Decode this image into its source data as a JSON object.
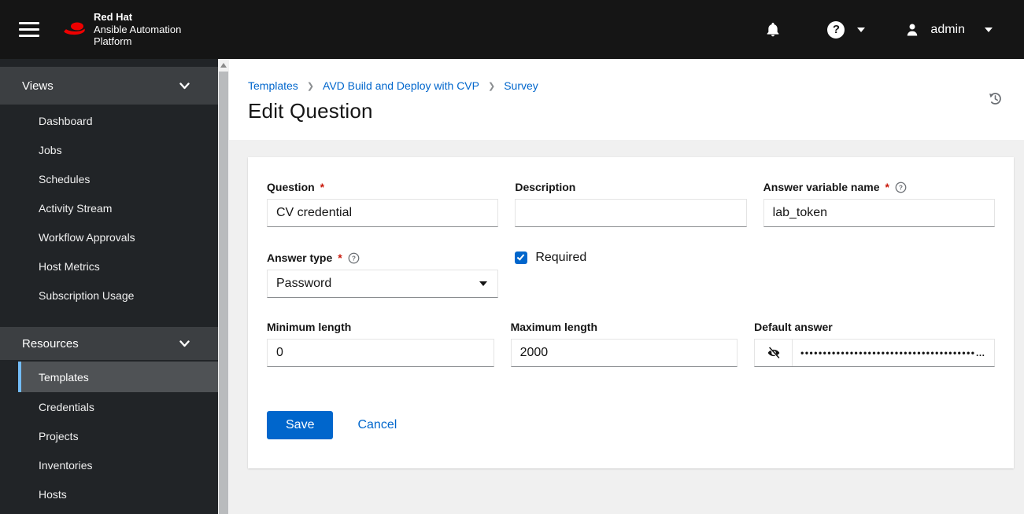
{
  "masthead": {
    "brand": {
      "line1": "Red Hat",
      "line2": "Ansible Automation",
      "line3": "Platform"
    },
    "user_menu": {
      "username": "admin"
    }
  },
  "sidebar": {
    "sections": [
      {
        "label": "Views",
        "items": [
          {
            "label": "Dashboard"
          },
          {
            "label": "Jobs"
          },
          {
            "label": "Schedules"
          },
          {
            "label": "Activity Stream"
          },
          {
            "label": "Workflow Approvals"
          },
          {
            "label": "Host Metrics"
          },
          {
            "label": "Subscription Usage"
          }
        ]
      },
      {
        "label": "Resources",
        "items": [
          {
            "label": "Templates",
            "active": true
          },
          {
            "label": "Credentials"
          },
          {
            "label": "Projects"
          },
          {
            "label": "Inventories"
          },
          {
            "label": "Hosts"
          }
        ]
      }
    ]
  },
  "breadcrumb": {
    "separator": "❯",
    "items": [
      {
        "label": "Templates"
      },
      {
        "label": "AVD Build and Deploy with CVP"
      },
      {
        "label": "Survey"
      }
    ]
  },
  "page": {
    "title": "Edit Question"
  },
  "form": {
    "question": {
      "label": "Question",
      "required": "*",
      "value": "CV credential"
    },
    "description": {
      "label": "Description",
      "value": ""
    },
    "answer_variable_name": {
      "label": "Answer variable name",
      "required": "*",
      "value": "lab_token"
    },
    "answer_type": {
      "label": "Answer type",
      "required": "*",
      "selected": "Password"
    },
    "required_checkbox": {
      "label": "Required",
      "checked": true
    },
    "minimum_length": {
      "label": "Minimum length",
      "value": "0"
    },
    "maximum_length": {
      "label": "Maximum length",
      "value": "2000"
    },
    "default_answer": {
      "label": "Default answer",
      "masked_value": "•••••••••••••••••••••••••••••••••••••••…"
    },
    "actions": {
      "save": "Save",
      "cancel": "Cancel"
    }
  },
  "icons": {
    "menu": "hamburger-bars",
    "notifications": "bell",
    "help": "question-circle",
    "user": "person-silhouette",
    "section_toggle": "chevron-down",
    "breadcrumb_separator": "chevron-right",
    "history": "history-clock",
    "answer_type_caret": "caret-down",
    "default_answer_toggle": "eye-slash",
    "field_help": "question-circle-outline"
  },
  "colors": {
    "accent": "#0066cc",
    "masthead_bg": "#151515",
    "sidebar_bg": "#212427",
    "sidebar_section_bg": "#3c3f42",
    "sidebar_active_bg": "#4f5255",
    "active_indicator": "#73bcf7",
    "content_bg": "#f0f0f0",
    "required_red": "#c9190b",
    "brand_red": "#ee0000"
  }
}
